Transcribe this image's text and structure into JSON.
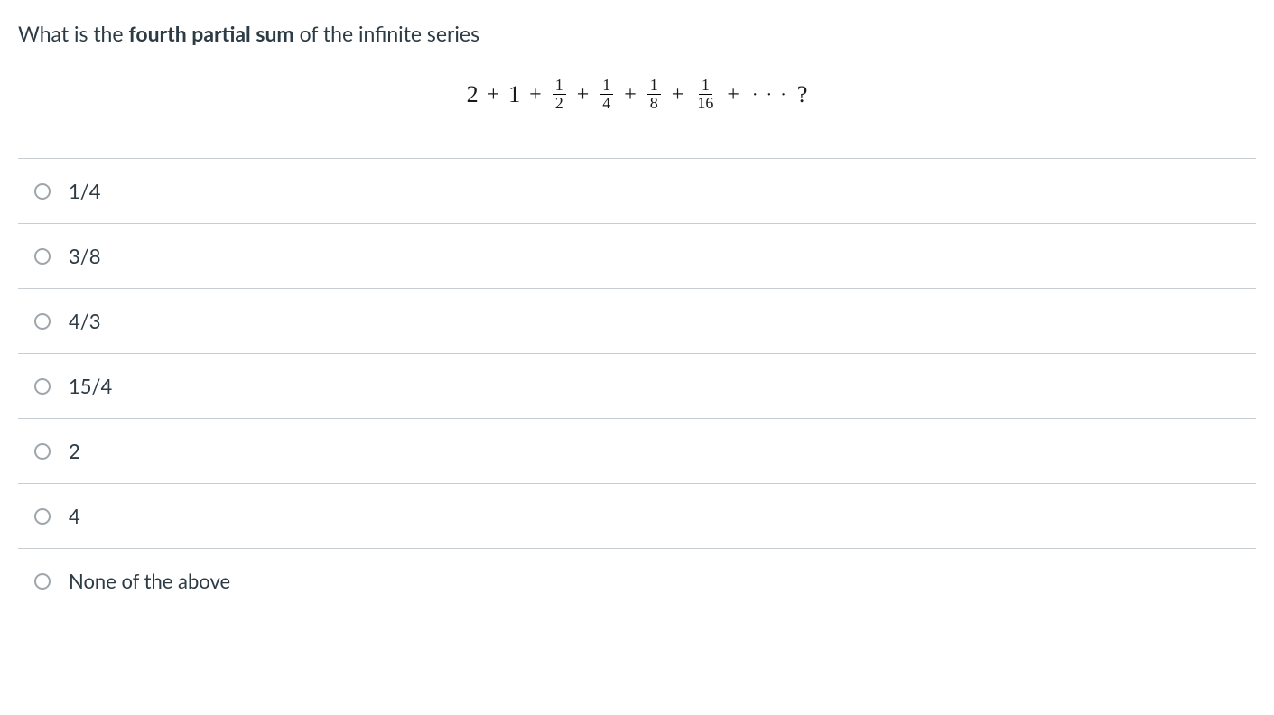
{
  "question": {
    "prefix": "What is the ",
    "bold": "fourth partial sum",
    "suffix": " of the infinite series"
  },
  "equation": {
    "terms": [
      "2",
      "1"
    ],
    "fractions": [
      {
        "num": "1",
        "den": "2"
      },
      {
        "num": "1",
        "den": "4"
      },
      {
        "num": "1",
        "den": "8"
      },
      {
        "num": "1",
        "den": "16"
      }
    ],
    "trailing": "?",
    "plus": "+",
    "dots": "· · ·"
  },
  "answers": [
    {
      "label": "1/4"
    },
    {
      "label": "3/8"
    },
    {
      "label": "4/3"
    },
    {
      "label": "15/4"
    },
    {
      "label": "2"
    },
    {
      "label": "4"
    },
    {
      "label": "None of the above"
    }
  ]
}
